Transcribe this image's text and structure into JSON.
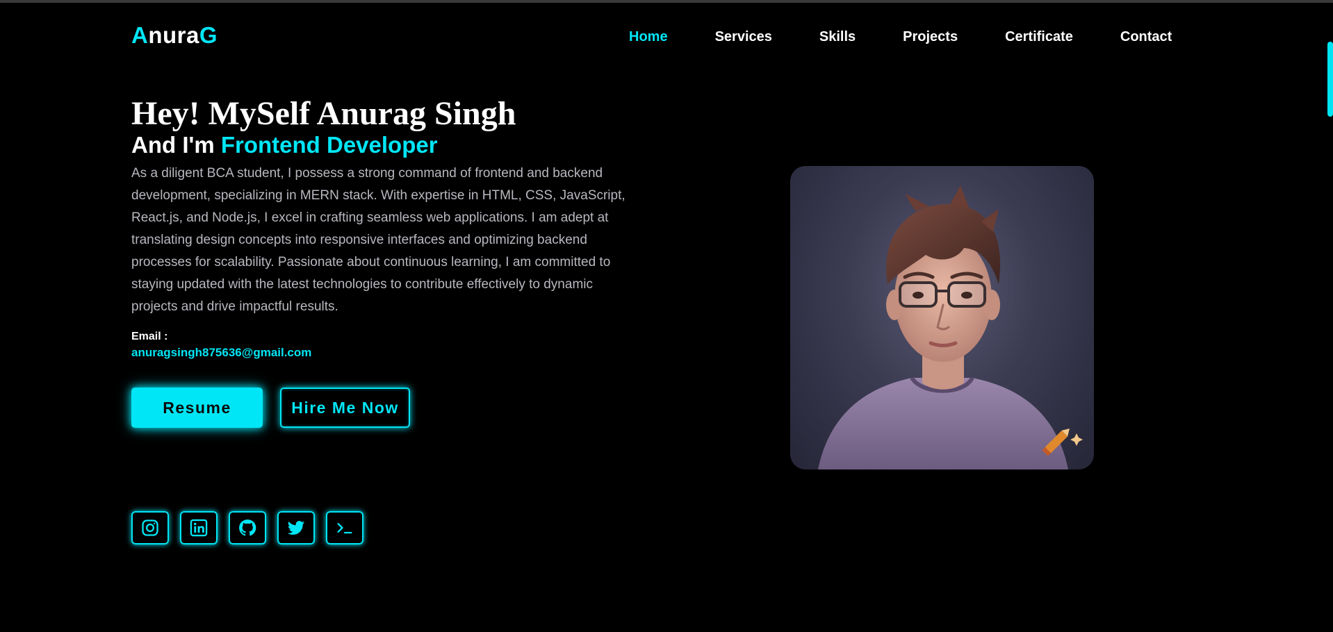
{
  "logo": {
    "first": "A",
    "middle": "nura",
    "last": "G"
  },
  "nav": {
    "items": [
      {
        "label": "Home",
        "active": true
      },
      {
        "label": "Services",
        "active": false
      },
      {
        "label": "Skills",
        "active": false
      },
      {
        "label": "Projects",
        "active": false
      },
      {
        "label": "Certificate",
        "active": false
      },
      {
        "label": "Contact",
        "active": false
      }
    ]
  },
  "hero": {
    "title": "Hey! MySelf Anurag Singh",
    "subtitle_prefix": "And I'm ",
    "subtitle_role": "Frontend Developer",
    "description": "As a diligent BCA student, I possess a strong command of frontend and backend development, specializing in MERN stack. With expertise in HTML, CSS, JavaScript, React.js, and Node.js, I excel in crafting seamless web applications. I am adept at translating design concepts into responsive interfaces and optimizing backend processes for scalability. Passionate about continuous learning, I am committed to staying updated with the latest technologies to contribute effectively to dynamic projects and drive impactful results.",
    "email_label": "Email :",
    "email": "anuragsingh875636@gmail.com",
    "resume_label": "Resume",
    "hire_label": "Hire Me Now"
  },
  "socials": [
    {
      "icon": "instagram-icon"
    },
    {
      "icon": "linkedin-icon"
    },
    {
      "icon": "github-icon"
    },
    {
      "icon": "twitter-icon"
    },
    {
      "icon": "terminal-icon"
    }
  ],
  "colors": {
    "accent": "#00e6f6",
    "background": "#000000",
    "text": "#ffffff",
    "muted_text": "#b8b8c0"
  }
}
